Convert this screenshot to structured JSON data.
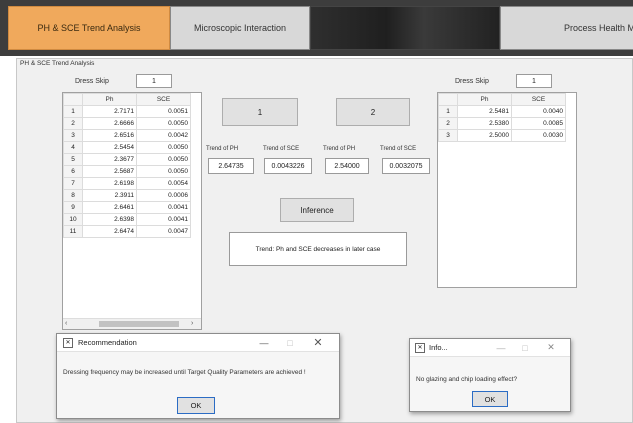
{
  "tabs": [
    {
      "label": "PH & SCE Trend Analysis",
      "active": true
    },
    {
      "label": "Microscopic Interaction",
      "active": false
    },
    {
      "label": "",
      "active": false
    },
    {
      "label": "Process Health M",
      "active": false
    }
  ],
  "panel_title": "PH & SCE Trend Analysis",
  "left": {
    "dress_skip_label": "Dress Skip",
    "dress_skip_value": "1",
    "columns": [
      "",
      "Ph",
      "SCE"
    ],
    "rows": [
      [
        "1",
        "2.7171",
        "0.0051"
      ],
      [
        "2",
        "2.6666",
        "0.0050"
      ],
      [
        "3",
        "2.6516",
        "0.0042"
      ],
      [
        "4",
        "2.5454",
        "0.0050"
      ],
      [
        "5",
        "2.3677",
        "0.0050"
      ],
      [
        "6",
        "2.5687",
        "0.0050"
      ],
      [
        "7",
        "2.6198",
        "0.0054"
      ],
      [
        "8",
        "2.3911",
        "0.0006"
      ],
      [
        "9",
        "2.6461",
        "0.0041"
      ],
      [
        "10",
        "2.6398",
        "0.0041"
      ],
      [
        "11",
        "2.6474",
        "0.0047"
      ]
    ]
  },
  "center": {
    "button1": "1",
    "button2": "2",
    "trend_labels": [
      "Trend of PH",
      "Trend of SCE",
      "Trend of PH",
      "Trend of SCE"
    ],
    "trend_values": [
      "2.64735",
      "0.0043226",
      "2.54000",
      "0.0032075"
    ],
    "inference_button": "Inference",
    "inference_text": "Trend: Ph and SCE decreases in later case"
  },
  "right": {
    "dress_skip_label": "Dress Skip",
    "dress_skip_value": "1",
    "columns": [
      "",
      "Ph",
      "SCE"
    ],
    "rows": [
      [
        "1",
        "2.5481",
        "0.0040"
      ],
      [
        "2",
        "2.5380",
        "0.0085"
      ],
      [
        "3",
        "2.5000",
        "0.0030"
      ]
    ]
  },
  "dialog1": {
    "title": "Recommendation",
    "message": "Dressing frequency may be increased until Target Quality Parameters are achieved !",
    "ok": "OK"
  },
  "dialog2": {
    "title": "Info...",
    "message": "No glazing and chip loading effect?",
    "ok": "OK"
  }
}
